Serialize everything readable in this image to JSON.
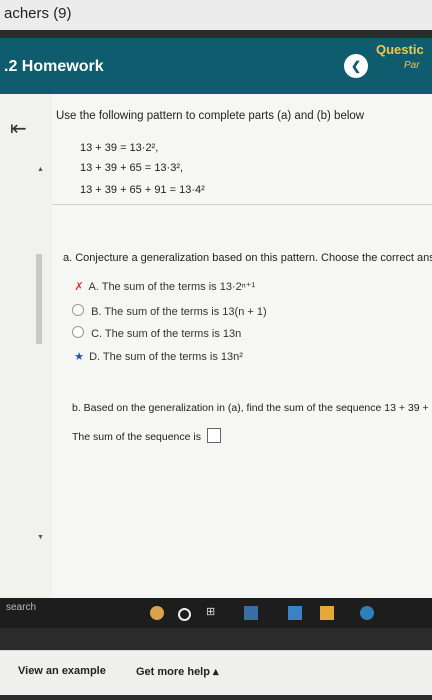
{
  "browser": {
    "tab_title": "achers (9)"
  },
  "header": {
    "title": ".2 Homework",
    "back_glyph": "❮",
    "question_label": "Questic",
    "part_label": "Par"
  },
  "problem": {
    "instruction": "Use the following pattern to complete parts (a) and (b) below",
    "equations": [
      "13 + 39 = 13·2²,",
      "13 + 39 + 65 = 13·3²,",
      "13 + 39 + 65 + 91 = 13·4²"
    ]
  },
  "part_a": {
    "prompt": "a. Conjecture a generalization based on this pattern. Choose the correct ans",
    "options": [
      {
        "letter": "A.",
        "text": "The sum of the terms is 13·2ⁿ⁺¹",
        "mark": "✗"
      },
      {
        "letter": "B.",
        "text": "The sum of the terms is 13(n + 1)",
        "mark": ""
      },
      {
        "letter": "C.",
        "text": "The sum of the terms is 13n",
        "mark": ""
      },
      {
        "letter": "D.",
        "text": "The sum of the terms is 13n²",
        "mark": "★"
      }
    ]
  },
  "part_b": {
    "prompt": "b. Based on the generalization in (a), find the sum of the sequence 13 + 39 + 6",
    "answer_label": "The sum of the sequence is"
  },
  "footer": {
    "view_example": "View an example",
    "get_more_help": "Get more help ▴"
  },
  "taskbar": {
    "search": "search"
  },
  "colors": {
    "header_bg": "#0e5c6e",
    "accent_yellow": "#f0c84b",
    "wrong": "#d33",
    "correct": "#1a56b0"
  }
}
